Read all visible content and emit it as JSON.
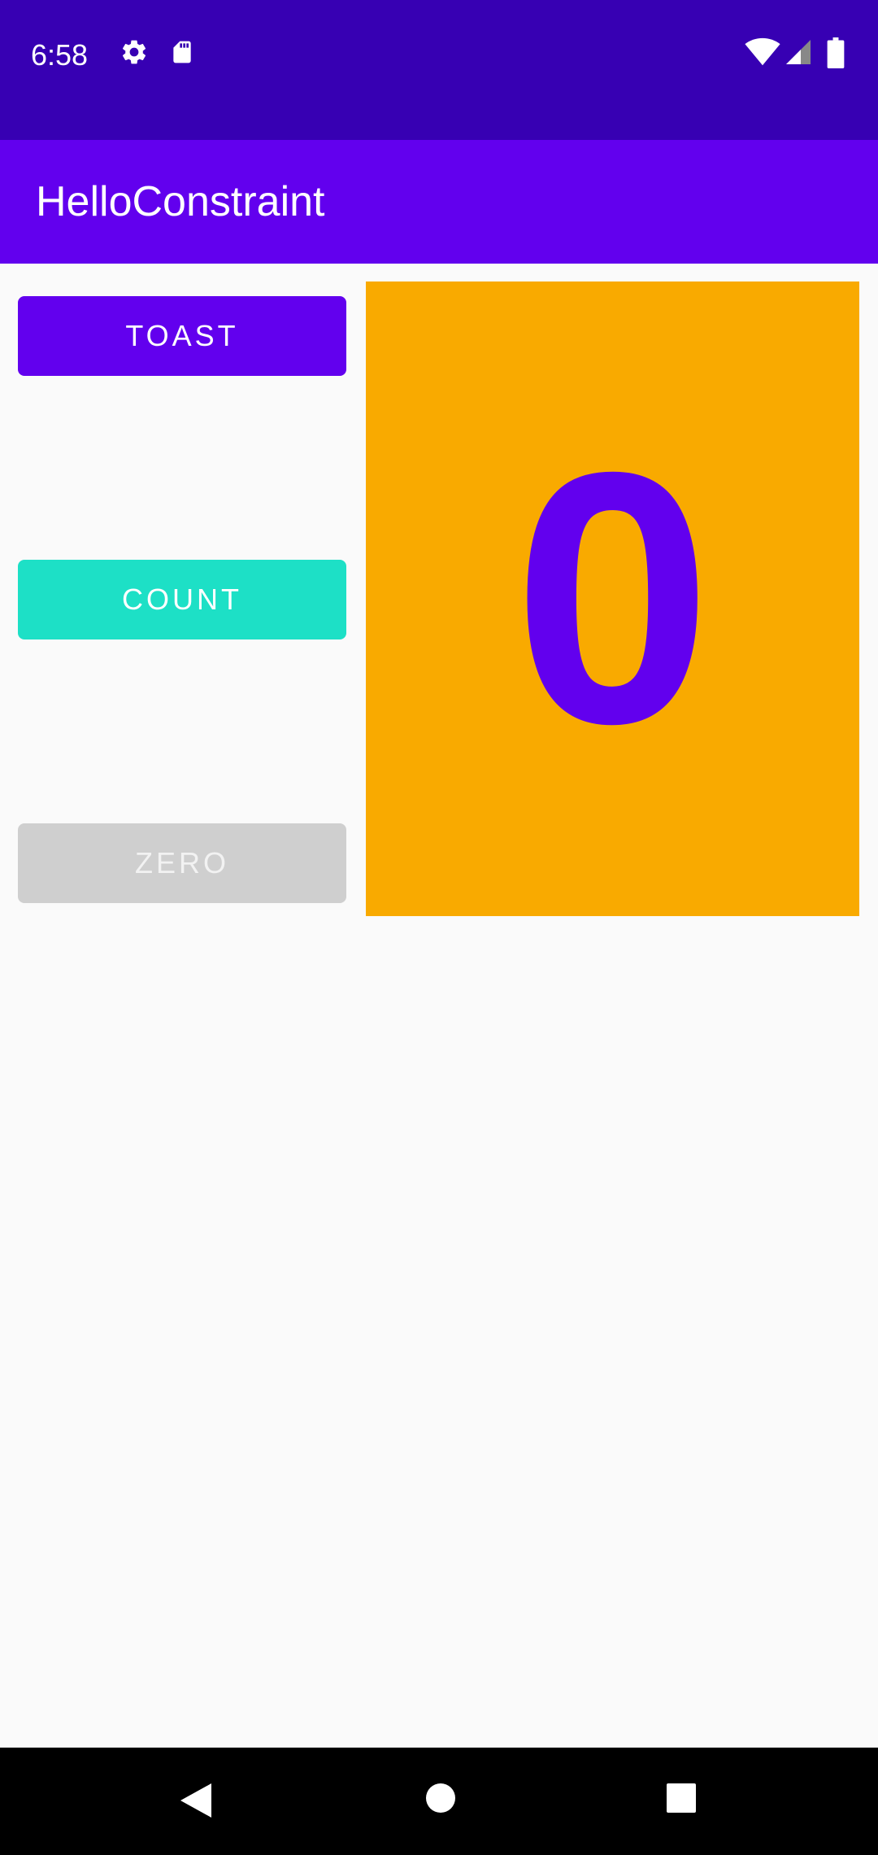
{
  "status_bar": {
    "time": "6:58",
    "icons": [
      "gear-icon",
      "sd-card-icon",
      "wifi-icon",
      "cell-signal-icon",
      "battery-icon"
    ]
  },
  "app_bar": {
    "title": "HelloConstraint"
  },
  "buttons": {
    "toast": "TOAST",
    "count": "COUNT",
    "zero": "ZERO"
  },
  "counter": {
    "value": "0"
  },
  "colors": {
    "status_bar": "#3700b3",
    "app_bar": "#6200ee",
    "toast_button": "#6200ee",
    "count_button": "#1de0c6",
    "zero_button": "#cfcfcf",
    "count_panel": "#f9aa00",
    "count_text": "#6200ee",
    "background": "#fafafa"
  },
  "nav_bar": {
    "icons": [
      "back-icon",
      "home-icon",
      "recents-icon"
    ]
  }
}
